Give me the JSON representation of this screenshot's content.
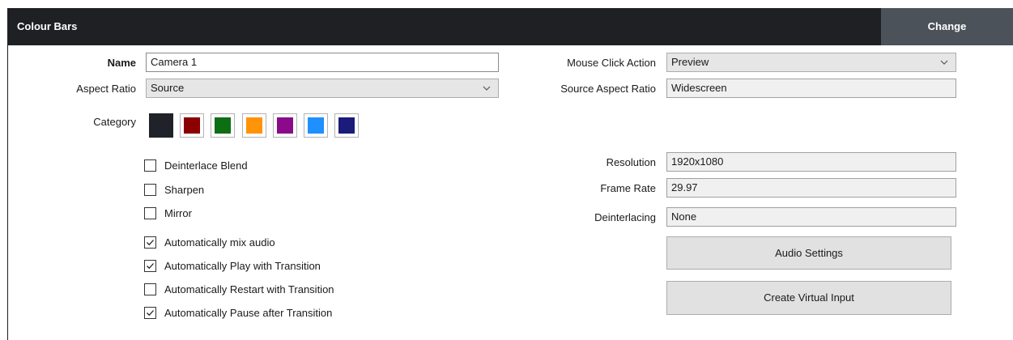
{
  "window": {
    "title": "Colour Bars",
    "change_label": "Change"
  },
  "left": {
    "name_label": "Name",
    "name_value": "Camera 1",
    "aspect_label": "Aspect Ratio",
    "aspect_value": "Source",
    "category_label": "Category",
    "category_colors": [
      "#1f2329",
      "#8b0000",
      "#0e6e14",
      "#ff9408",
      "#8b0a8b",
      "#1e90ff",
      "#1b1b7a"
    ],
    "category_selected": 0
  },
  "checkboxes": [
    {
      "label": "Deinterlace Blend",
      "checked": false
    },
    {
      "label": "Sharpen",
      "checked": false
    },
    {
      "label": "Mirror",
      "checked": false
    },
    {
      "label": "Automatically mix audio",
      "checked": true
    },
    {
      "label": "Automatically Play with Transition",
      "checked": true
    },
    {
      "label": "Automatically Restart with Transition",
      "checked": false
    },
    {
      "label": "Automatically Pause after Transition",
      "checked": true
    }
  ],
  "right": {
    "mouse_click_label": "Mouse Click Action",
    "mouse_click_value": "Preview",
    "source_aspect_label": "Source Aspect Ratio",
    "source_aspect_value": "Widescreen",
    "resolution_label": "Resolution",
    "resolution_value": "1920x1080",
    "frame_rate_label": "Frame Rate",
    "frame_rate_value": "29.97",
    "deinterlacing_label": "Deinterlacing",
    "deinterlacing_value": "None",
    "audio_settings_label": "Audio Settings",
    "create_virtual_label": "Create Virtual Input"
  }
}
